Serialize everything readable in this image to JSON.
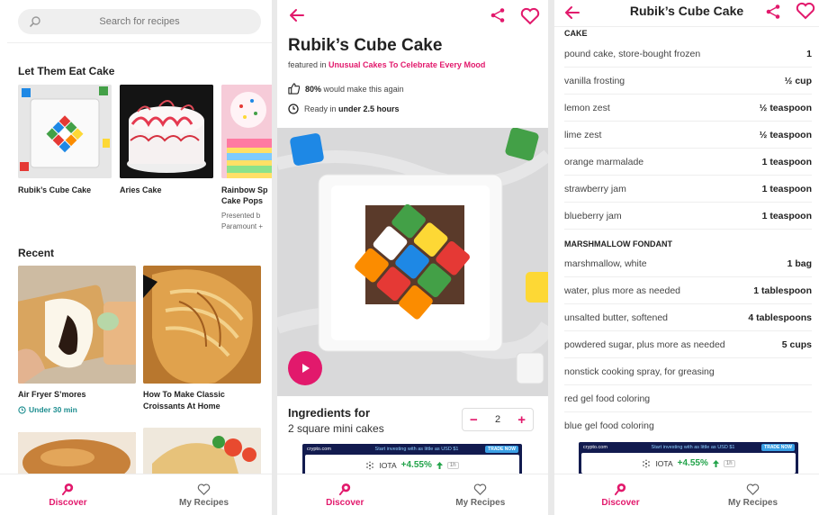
{
  "colors": {
    "accent": "#e2196c",
    "teal": "#1c8d8f",
    "ad_bg": "#121b4f",
    "ad_green": "#22a34a"
  },
  "nav": {
    "discover": "Discover",
    "my_recipes": "My Recipes"
  },
  "discover": {
    "search_placeholder": "Search for recipes",
    "section1_title": "Let Them Eat Cake",
    "cards": [
      {
        "title": "Rubik’s Cube Cake"
      },
      {
        "title": "Aries Cake"
      },
      {
        "title": "Rainbow Sp",
        "title2": "Cake Pops",
        "sub1": "Presented b",
        "sub2": "Paramount +"
      }
    ],
    "section2_title": "Recent",
    "recent": [
      {
        "title": "Air Fryer S’mores",
        "time": "Under 30 min"
      },
      {
        "title": "How To Make Classic",
        "title2": "Croissants At Home"
      }
    ]
  },
  "recipe": {
    "title": "Rubik’s Cube Cake",
    "featured_prefix": "featured in",
    "featured_link": "Unusual Cakes To Celebrate Every Mood",
    "rating_pct": "80%",
    "rating_text": "would make this again",
    "ready_prefix": "Ready in",
    "ready_time": "under 2.5 hours",
    "ingredients_for": "Ingredients for",
    "servings": "2 square mini cakes",
    "servings_count": "2",
    "minus": "−",
    "plus": "+"
  },
  "ad": {
    "brand": "crypto.com",
    "tagline": "Start investing with as little as USD $1",
    "cta": "TRADE NOW",
    "coin": "IOTA",
    "change": "+4.55%",
    "period": "1h"
  },
  "ingredients": {
    "header_title": "Rubik’s Cube Cake",
    "groups": [
      {
        "name": "CAKE",
        "items": [
          {
            "name": "pound cake, store-bought frozen",
            "amount": "1"
          },
          {
            "name": "vanilla frosting",
            "amount": "½ cup"
          },
          {
            "name": "lemon zest",
            "amount": "½ teaspoon"
          },
          {
            "name": "lime zest",
            "amount": "½ teaspoon"
          },
          {
            "name": "orange marmalade",
            "amount": "1 teaspoon"
          },
          {
            "name": "strawberry jam",
            "amount": "1 teaspoon"
          },
          {
            "name": "blueberry jam",
            "amount": "1 teaspoon"
          }
        ]
      },
      {
        "name": "MARSHMALLOW FONDANT",
        "items": [
          {
            "name": "marshmallow, white",
            "amount": "1 bag"
          },
          {
            "name": "water, plus more as needed",
            "amount": "1 tablespoon"
          },
          {
            "name": "unsalted butter, softened",
            "amount": "4 tablespoons"
          },
          {
            "name": "powdered sugar, plus more as needed",
            "amount": "5 cups"
          },
          {
            "name": "nonstick cooking spray, for greasing",
            "amount": ""
          },
          {
            "name": "red gel food coloring",
            "amount": ""
          },
          {
            "name": "blue gel food coloring",
            "amount": ""
          }
        ]
      }
    ]
  }
}
